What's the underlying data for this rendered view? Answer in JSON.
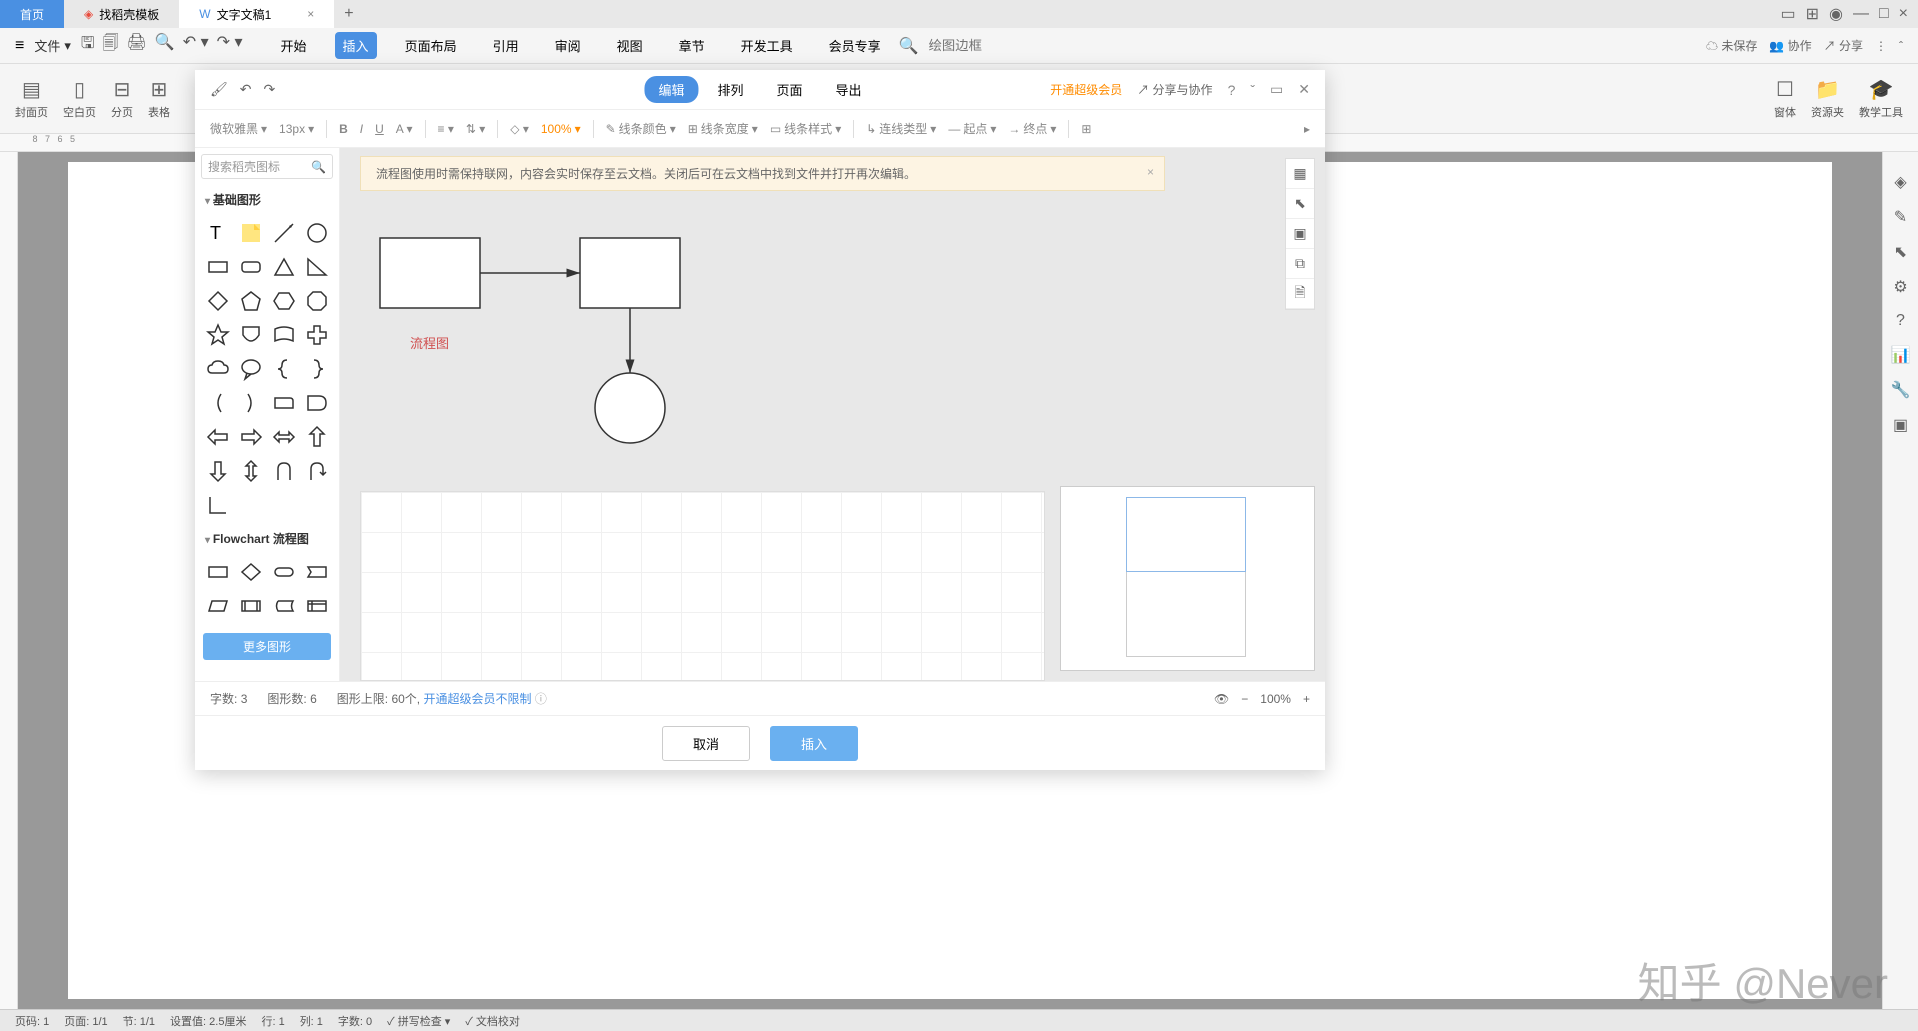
{
  "tabs": {
    "home": "首页",
    "template": "找稻壳模板",
    "doc": "文字文稿1"
  },
  "menu": {
    "file": "文件",
    "items": [
      "开始",
      "插入",
      "页面布局",
      "引用",
      "审阅",
      "视图",
      "章节",
      "开发工具",
      "会员专享"
    ],
    "active_index": 1,
    "search_placeholder": "绘图边框",
    "right": {
      "unsaved": "未保存",
      "collab": "协作",
      "share": "分享"
    }
  },
  "ribbon": {
    "groups": [
      "封面页",
      "空白页",
      "分页",
      "表格"
    ],
    "right_groups": [
      "窗体",
      "资源夹",
      "教学工具"
    ]
  },
  "dialog": {
    "tabs": [
      "编辑",
      "排列",
      "页面",
      "导出"
    ],
    "active_tab": 0,
    "premium": "开通超级会员",
    "share": "分享与协作",
    "toolbar": {
      "font": "微软雅黑",
      "size": "13px",
      "opacity": "100%",
      "line_color": "线条颜色",
      "line_width": "线条宽度",
      "line_style": "线条样式",
      "conn_type": "连线类型",
      "start": "起点",
      "end": "终点"
    },
    "search_placeholder": "搜索稻壳图标",
    "categories": {
      "basic": "基础图形",
      "flowchart": "Flowchart 流程图"
    },
    "more_shapes": "更多图形",
    "notice": "流程图使用时需保持联网，内容会实时保存至云文档。关闭后可在云文档中找到文件并打开再次编辑。",
    "canvas_label": "流程图",
    "stats": {
      "chars_label": "字数:",
      "chars": "3",
      "shapes_label": "图形数:",
      "shapes": "6",
      "limit_label": "图形上限:",
      "limit": "60个,",
      "premium_unlimited": "开通超级会员不限制"
    },
    "zoom": "100%",
    "cancel": "取消",
    "insert": "插入"
  },
  "statusbar": {
    "page_no": "页码: 1",
    "page": "页面: 1/1",
    "section": "节: 1/1",
    "setting": "设置值: 2.5厘米",
    "row": "行: 1",
    "col": "列: 1",
    "chars": "字数: 0",
    "spellcheck": "拼写检查",
    "doccheck": "文档校对"
  },
  "watermark": "知乎 @Never"
}
